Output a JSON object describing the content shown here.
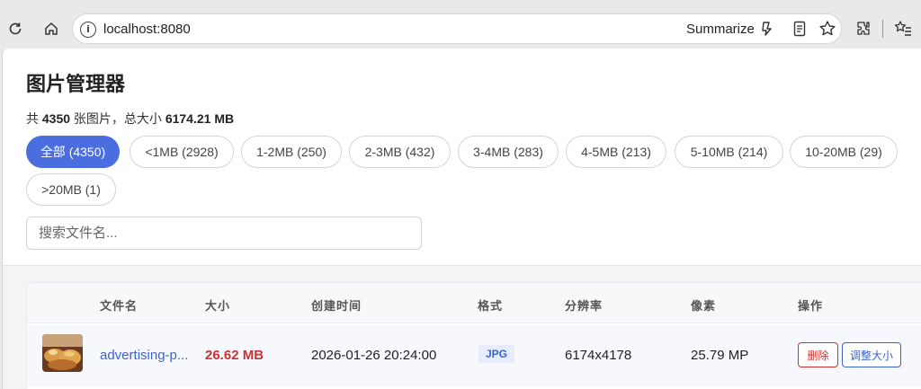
{
  "browser": {
    "url": "localhost:8080",
    "summarize_label": "Summarize",
    "icons": [
      "reload-icon",
      "home-icon",
      "info-icon",
      "copilot-icon",
      "reading-mode-icon",
      "favorite-star-icon",
      "extensions-icon",
      "favorites-list-icon"
    ]
  },
  "header": {
    "title": "图片管理器",
    "stats_prefix": "共 ",
    "stats_count": "4350",
    "stats_mid": " 张图片，总大小 ",
    "stats_size": "6174.21 MB"
  },
  "filters": [
    {
      "label": "全部 (4350)",
      "active": true
    },
    {
      "label": "<1MB (2928)",
      "active": false
    },
    {
      "label": "1-2MB (250)",
      "active": false
    },
    {
      "label": "2-3MB (432)",
      "active": false
    },
    {
      "label": "3-4MB (283)",
      "active": false
    },
    {
      "label": "4-5MB (213)",
      "active": false
    },
    {
      "label": "5-10MB (214)",
      "active": false
    },
    {
      "label": "10-20MB (29)",
      "active": false
    },
    {
      "label": ">20MB (1)",
      "active": false
    }
  ],
  "search": {
    "placeholder": "搜索文件名..."
  },
  "table": {
    "columns": [
      "文件名",
      "大小",
      "创建时间",
      "格式",
      "分辨率",
      "像素",
      "操作"
    ],
    "rows": [
      {
        "filename": "advertising-p...",
        "size": "26.62 MB",
        "created": "2026-01-26 20:24:00",
        "format": "JPG",
        "resolution": "6174x4178",
        "pixels": "25.79 MP",
        "delete_label": "删除",
        "resize_label": "调整大小"
      }
    ]
  },
  "colors": {
    "accent": "#4a6ee0",
    "size_red": "#c83232",
    "link_blue": "#3c64c8"
  }
}
